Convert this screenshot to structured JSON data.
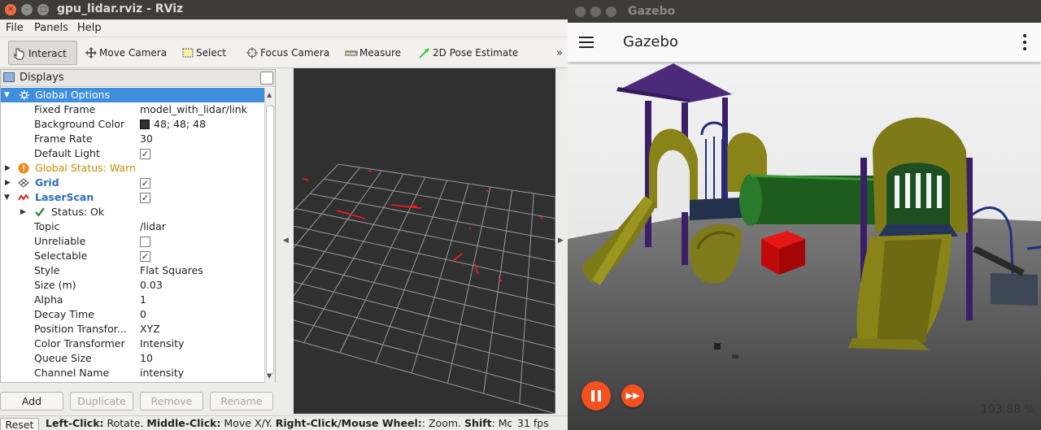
{
  "rviz": {
    "window_title": "gpu_lidar.rviz - RViz",
    "menu": [
      "File",
      "Panels",
      "Help"
    ],
    "tools": [
      "Interact",
      "Move Camera",
      "Select",
      "Focus Camera",
      "Measure",
      "2D Pose Estimate"
    ],
    "toolbar_more": "»",
    "displays": {
      "title": "Displays",
      "rows": [
        {
          "name": "Global Options",
          "value": ""
        },
        {
          "name": "Fixed Frame",
          "value": "model_with_lidar/link"
        },
        {
          "name": "Background Color",
          "value": "48; 48; 48"
        },
        {
          "name": "Frame Rate",
          "value": "30"
        },
        {
          "name": "Default Light",
          "value": ""
        },
        {
          "name": "Global Status: Warn",
          "value": ""
        },
        {
          "name": "Grid",
          "value": ""
        },
        {
          "name": "LaserScan",
          "value": ""
        },
        {
          "name": "Status: Ok",
          "value": ""
        },
        {
          "name": "Topic",
          "value": "/lidar"
        },
        {
          "name": "Unreliable",
          "value": ""
        },
        {
          "name": "Selectable",
          "value": ""
        },
        {
          "name": "Style",
          "value": "Flat Squares"
        },
        {
          "name": "Size (m)",
          "value": "0.03"
        },
        {
          "name": "Alpha",
          "value": "1"
        },
        {
          "name": "Decay Time",
          "value": "0"
        },
        {
          "name": "Position Transfor...",
          "value": "XYZ"
        },
        {
          "name": "Color Transformer",
          "value": "Intensity"
        },
        {
          "name": "Queue Size",
          "value": "10"
        },
        {
          "name": "Channel Name",
          "value": "intensity"
        }
      ],
      "checks": {
        "default_light": "✓",
        "grid": "✓",
        "laserscan": "✓",
        "unreliable": "",
        "selectable": "✓"
      }
    },
    "buttons": {
      "add": "Add",
      "duplicate": "Duplicate",
      "remove": "Remove",
      "rename": "Rename"
    },
    "status": {
      "reset": "Reset",
      "lc": "Left-Click:",
      "lc_t": " Rotate. ",
      "mc": "Middle-Click:",
      "mc_t": " Move X/Y. ",
      "rc": "Right-Click/Mouse Wheel:",
      "rc_t": ": Zoom. ",
      "sh": "Shift",
      "sh_t": ": More o",
      "fps": "31 fps"
    }
  },
  "gazebo": {
    "window_title": "Gazebo",
    "app_title": "Gazebo",
    "rtf_chevron": "‹",
    "real_time_factor": "103.88 %"
  },
  "colors": {
    "selection": "#3f8ede",
    "gazebo_accent": "#f4511e",
    "rviz_bg": "#303030",
    "warn": "#d08a00"
  },
  "icons": [
    "close-icon",
    "minimize-icon",
    "maximize-icon",
    "interact-icon",
    "move-camera-icon",
    "select-icon",
    "focus-camera-icon",
    "measure-icon",
    "pose-estimate-icon",
    "hamburger-menu-icon",
    "kebab-menu-icon",
    "pause-icon",
    "fast-forward-icon"
  ]
}
